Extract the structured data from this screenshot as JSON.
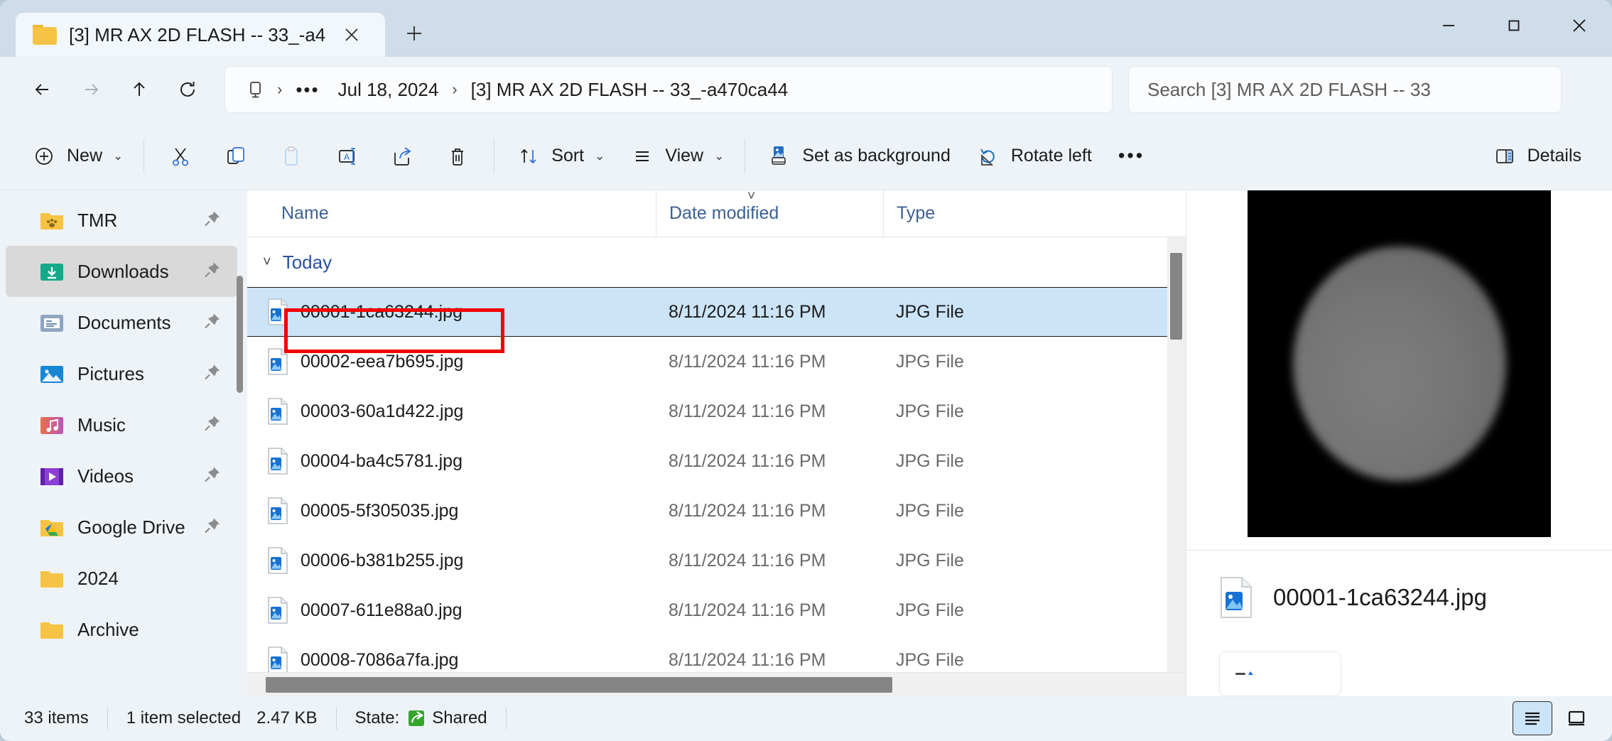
{
  "window": {
    "tab": {
      "title": "[3] MR AX 2D FLASH -- 33_-a4",
      "folder_icon": "folder-icon",
      "close_icon": "close-icon"
    },
    "new_tab_label": "+",
    "controls": {
      "minimize": "minimize-icon",
      "maximize": "maximize-icon",
      "close": "close-icon"
    }
  },
  "nav": {
    "back": "back-arrow-icon",
    "forward": "forward-arrow-icon",
    "up": "up-arrow-icon",
    "refresh": "refresh-icon"
  },
  "address": {
    "root_icon": "this-pc-icon",
    "separator": "›",
    "ellipsis": "•••",
    "crumbs": [
      "Jul 18, 2024",
      "[3] MR AX 2D FLASH -- 33_-a470ca44"
    ]
  },
  "search": {
    "placeholder": "Search [3] MR AX 2D FLASH -- 33",
    "value": ""
  },
  "toolbar": {
    "new_label": "New",
    "new_icon": "plus-circle-icon",
    "cut_icon": "scissors-icon",
    "copy_icon": "copy-icon",
    "paste_icon": "paste-icon",
    "rename_icon": "rename-icon",
    "share_icon": "share-icon",
    "delete_icon": "trash-icon",
    "sort_label": "Sort",
    "sort_icon": "sort-icon",
    "view_label": "View",
    "view_icon": "view-list-icon",
    "set_background_label": "Set as background",
    "set_background_icon": "picture-icon",
    "rotate_left_label": "Rotate left",
    "rotate_left_icon": "rotate-left-icon",
    "more_label": "•••",
    "details_label": "Details",
    "details_icon": "details-pane-icon",
    "chevron": "⌄"
  },
  "sidebar": {
    "items": [
      {
        "label": "TMR",
        "icon": "folder-paw-icon",
        "pinned": true,
        "selected": false
      },
      {
        "label": "Downloads",
        "icon": "downloads-folder-icon",
        "pinned": true,
        "selected": true
      },
      {
        "label": "Documents",
        "icon": "documents-folder-icon",
        "pinned": true,
        "selected": false
      },
      {
        "label": "Pictures",
        "icon": "pictures-folder-icon",
        "pinned": true,
        "selected": false
      },
      {
        "label": "Music",
        "icon": "music-folder-icon",
        "pinned": true,
        "selected": false
      },
      {
        "label": "Videos",
        "icon": "videos-folder-icon",
        "pinned": true,
        "selected": false
      },
      {
        "label": "Google Drive",
        "icon": "google-drive-icon",
        "pinned": true,
        "selected": false
      },
      {
        "label": "2024",
        "icon": "folder-icon",
        "pinned": false,
        "selected": false
      },
      {
        "label": "Archive",
        "icon": "folder-icon",
        "pinned": false,
        "selected": false
      }
    ]
  },
  "filelist": {
    "columns": [
      "Name",
      "Date modified",
      "Type"
    ],
    "sorted_column": "Date modified",
    "group": {
      "label": "Today",
      "expanded": true
    },
    "rows": [
      {
        "name": "00001-1ca63244.jpg",
        "date": "8/11/2024 11:16 PM",
        "type": "JPG File",
        "selected": true,
        "annotated": true
      },
      {
        "name": "00002-eea7b695.jpg",
        "date": "8/11/2024 11:16 PM",
        "type": "JPG File",
        "selected": false,
        "annotated": false
      },
      {
        "name": "00003-60a1d422.jpg",
        "date": "8/11/2024 11:16 PM",
        "type": "JPG File",
        "selected": false,
        "annotated": false
      },
      {
        "name": "00004-ba4c5781.jpg",
        "date": "8/11/2024 11:16 PM",
        "type": "JPG File",
        "selected": false,
        "annotated": false
      },
      {
        "name": "00005-5f305035.jpg",
        "date": "8/11/2024 11:16 PM",
        "type": "JPG File",
        "selected": false,
        "annotated": false
      },
      {
        "name": "00006-b381b255.jpg",
        "date": "8/11/2024 11:16 PM",
        "type": "JPG File",
        "selected": false,
        "annotated": false
      },
      {
        "name": "00007-611e88a0.jpg",
        "date": "8/11/2024 11:16 PM",
        "type": "JPG File",
        "selected": false,
        "annotated": false
      },
      {
        "name": "00008-7086a7fa.jpg",
        "date": "8/11/2024 11:16 PM",
        "type": "JPG File",
        "selected": false,
        "annotated": false
      }
    ]
  },
  "details_pane": {
    "preview_alt": "mri-axial-scan-preview",
    "filename": "00001-1ca63244.jpg",
    "file_icon": "jpg-file-icon"
  },
  "statusbar": {
    "item_count": "33 items",
    "selection": "1 item selected",
    "size": "2.47 KB",
    "state_label": "State:",
    "state_value": "Shared",
    "state_icon": "shared-green-icon",
    "view_details_icon": "details-view-icon",
    "view_large_icons_icon": "large-icons-view-icon"
  },
  "colors": {
    "titlebar": "#cfdce9",
    "chrome": "#eef3f8",
    "selection": "#cce4f7",
    "accent_link": "#2c4fa0",
    "annotation": "#f20000",
    "shared_green": "#35a52e"
  }
}
